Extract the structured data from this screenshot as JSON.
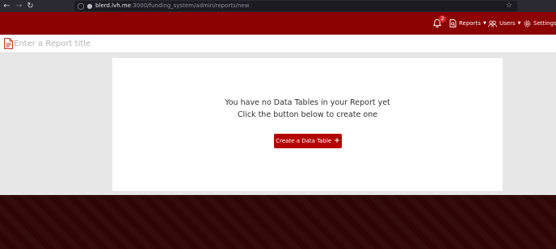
{
  "browser": {
    "url_host": "blerd.lvh.me",
    "url_path": ":3000/funding_system/admin/reports/new"
  },
  "header": {
    "notifications_count": "2",
    "menu": {
      "reports": "Reports",
      "users": "Users",
      "settings": "Settings"
    }
  },
  "report": {
    "title_placeholder": "Enter a Report title",
    "empty_line1": "You have no Data Tables in your Report yet",
    "empty_line2": "Click the button below to create one",
    "create_button": "Create a Data Table",
    "create_button_icon": "+"
  },
  "colors": {
    "header_bg": "#8b0000",
    "accent_button": "#b30000",
    "footer_bg": "#2e0606",
    "page_bg": "#e7e7e7"
  }
}
